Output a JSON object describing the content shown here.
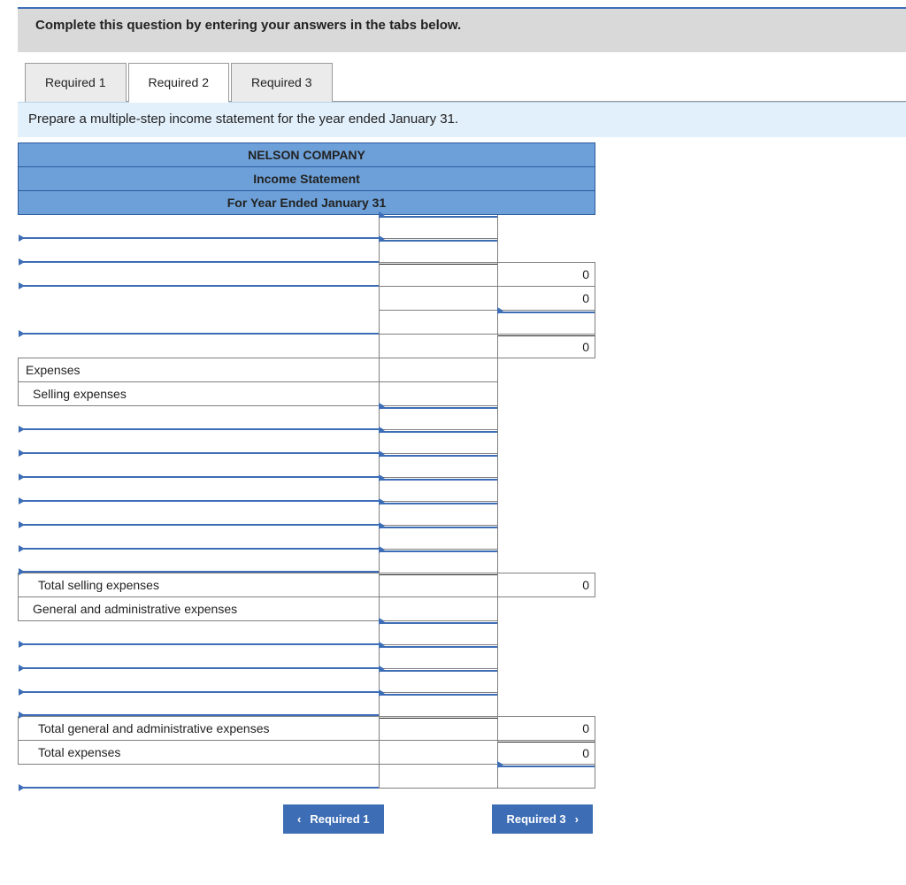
{
  "instruction": "Complete this question by entering your answers in the tabs below.",
  "tabs": [
    "Required 1",
    "Required 2",
    "Required 3"
  ],
  "activeTab": 1,
  "subheader": "Prepare a multiple-step income statement for the year ended January 31.",
  "header": {
    "company": "NELSON COMPANY",
    "title": "Income Statement",
    "period": "For Year Ended January 31"
  },
  "labels": {
    "expenses": "Expenses",
    "selling": "Selling expenses",
    "totalSelling": "Total selling expenses",
    "ga": "General and administrative expenses",
    "totalGA": "Total general and administrative expenses",
    "totalExp": "Total expenses"
  },
  "values": {
    "zeroA": "0",
    "zeroB": "0",
    "zeroC": "0",
    "totSell": "0",
    "totGA": "0",
    "totExp": "0"
  },
  "nav": {
    "prev": "Required 1",
    "next": "Required 3"
  }
}
